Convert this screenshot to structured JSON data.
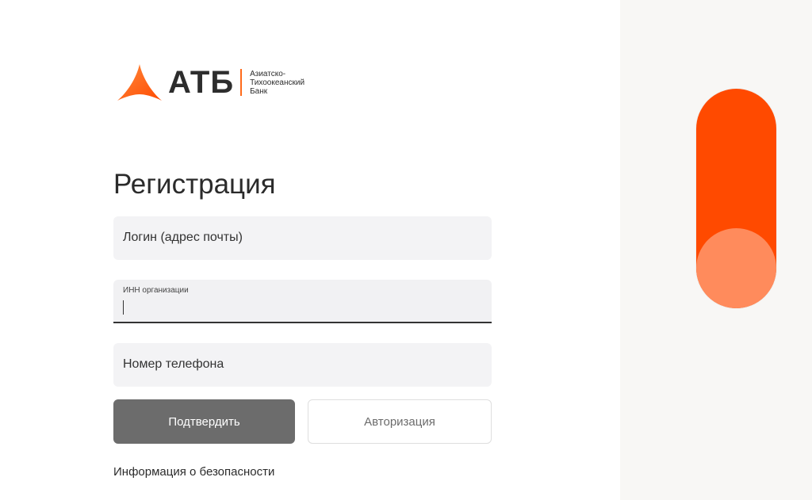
{
  "brand": {
    "abbr": "АТБ",
    "name_line1": "Азиатско-",
    "name_line2": "Тихоокеанский",
    "name_line3": "Банк",
    "accent_color": "#ff4a00"
  },
  "page": {
    "title": "Регистрация"
  },
  "form": {
    "login_placeholder": "Логин (адрес почты)",
    "inn_label": "ИНН организации",
    "inn_value": "",
    "phone_placeholder": "Номер телефона",
    "confirm_label": "Подтвердить",
    "auth_label": "Авторизация",
    "confirm_color": "#6c6c6c"
  },
  "footer": {
    "security_link": "Информация о безопасности"
  },
  "toggle": {
    "state": "off",
    "track_color": "#ff4a00",
    "knob_color": "#ff8b5c"
  }
}
